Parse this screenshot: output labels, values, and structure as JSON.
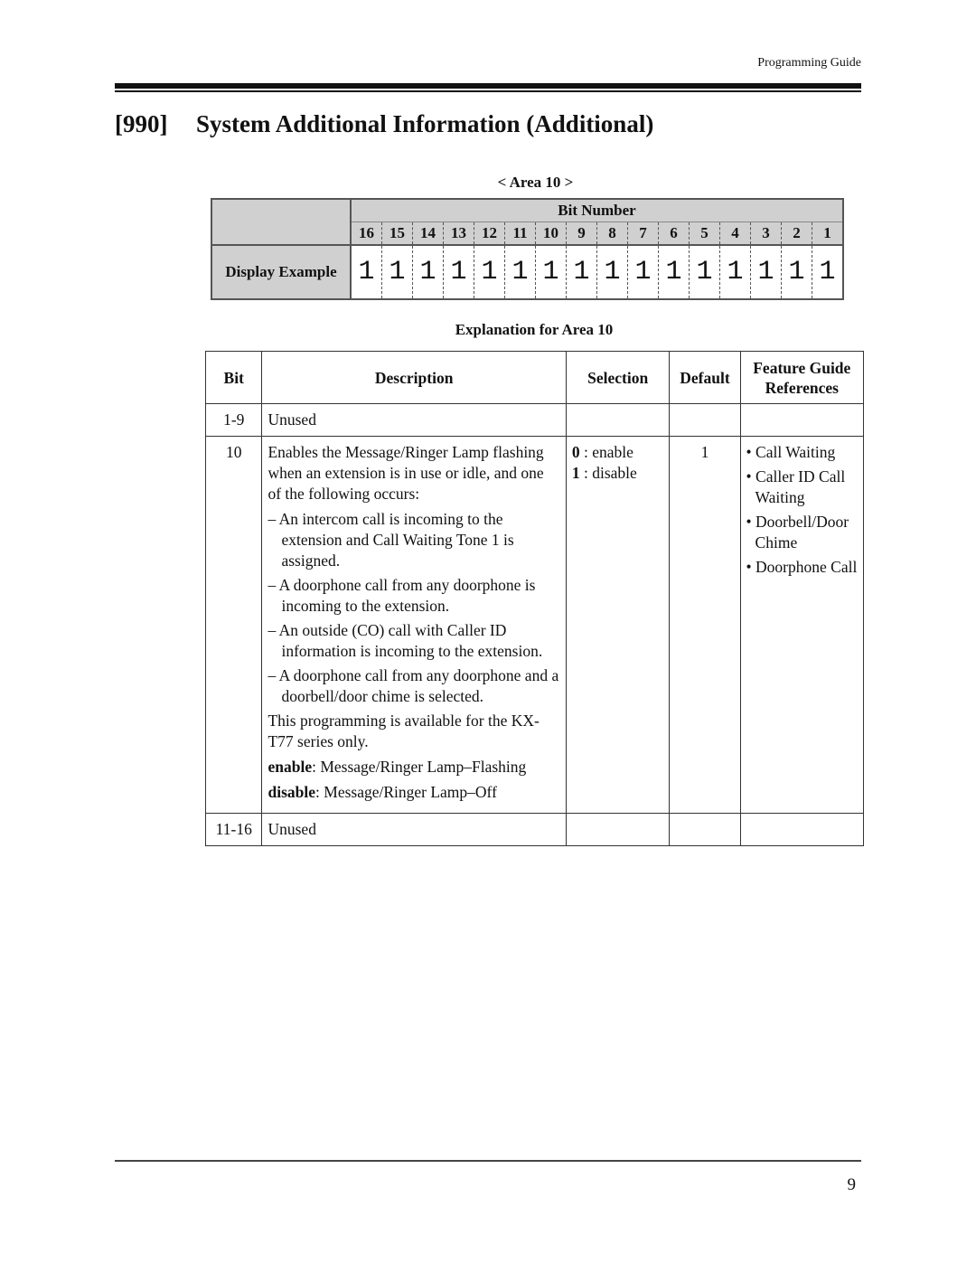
{
  "header": {
    "label": "Programming Guide"
  },
  "title": {
    "number": "[990]",
    "text": "System Additional Information (Additional)"
  },
  "area": {
    "label": "< Area 10 >",
    "bit_number_header": "Bit Number",
    "bits": [
      "16",
      "15",
      "14",
      "13",
      "12",
      "11",
      "10",
      "9",
      "8",
      "7",
      "6",
      "5",
      "4",
      "3",
      "2",
      "1"
    ],
    "display_example_label": "Display Example",
    "display_values": [
      "1",
      "1",
      "1",
      "1",
      "1",
      "1",
      "1",
      "1",
      "1",
      "1",
      "1",
      "1",
      "1",
      "1",
      "1",
      "1"
    ]
  },
  "explanation": {
    "label": "Explanation for Area 10",
    "columns": {
      "bit": "Bit",
      "description": "Description",
      "selection": "Selection",
      "default": "Default",
      "references": "Feature Guide References"
    },
    "rows": [
      {
        "bit": "1-9",
        "description": "Unused"
      },
      {
        "bit": "10",
        "description_intro": "Enables the Message/Ringer Lamp flashing when an extension is in use or idle, and one of the following occurs:",
        "conditions": [
          "– An intercom call is incoming to the extension and Call Waiting Tone 1 is assigned.",
          "– A doorphone call from any doorphone is incoming to the extension.",
          "– An outside (CO) call with Caller ID information is incoming to the extension.",
          "– A doorphone call from any doorphone and a doorbell/door chime is selected."
        ],
        "note": "This programming is available for the KX-T77 series only.",
        "enable_term": "enable",
        "enable_text": ": Message/Ringer Lamp–Flashing",
        "disable_term": "disable",
        "disable_text": ": Message/Ringer Lamp–Off",
        "selection": [
          {
            "value": "0",
            "text": " : enable"
          },
          {
            "value": "1",
            "text": " : disable"
          }
        ],
        "default": "1",
        "references": [
          "• Call Waiting",
          "• Caller ID Call Waiting",
          "• Doorbell/Door Chime",
          "• Doorphone Call"
        ]
      },
      {
        "bit": "11-16",
        "description": "Unused"
      }
    ]
  },
  "footer": {
    "page_number": "9"
  }
}
